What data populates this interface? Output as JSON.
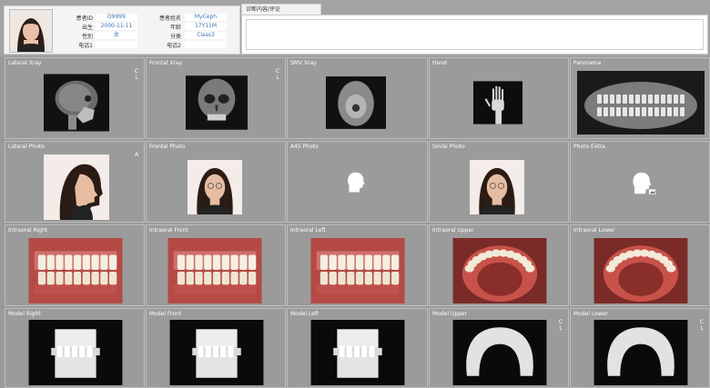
{
  "patient": {
    "fields": [
      {
        "label": "患者ID",
        "value": "D9999"
      },
      {
        "label": "出生",
        "value": "2000-11-11"
      },
      {
        "label": "性別",
        "value": "女"
      },
      {
        "label": "电话1",
        "value": ""
      },
      {
        "label": "患者姓名",
        "value": "MyCeph"
      },
      {
        "label": "年龄",
        "value": "17Y11M"
      },
      {
        "label": "分类",
        "value": "Class3"
      },
      {
        "label": "电话2",
        "value": ""
      }
    ]
  },
  "diagnosis": {
    "tab_label": "诊断内容/评论",
    "text": ""
  },
  "tiles": [
    {
      "title": "Lateral Xray",
      "corner": "C\nL"
    },
    {
      "title": "Frontal Xray",
      "corner": "C\nL"
    },
    {
      "title": "SMV Xray",
      "corner": ""
    },
    {
      "title": "Hand",
      "corner": ""
    },
    {
      "title": "Panorama",
      "corner": ""
    },
    {
      "title": "Lateral Photo",
      "corner": "A"
    },
    {
      "title": "Frontal Photo",
      "corner": ""
    },
    {
      "title": "A45 Photo",
      "corner": ""
    },
    {
      "title": "Smile Photo",
      "corner": ""
    },
    {
      "title": "Photo Extra",
      "corner": ""
    },
    {
      "title": "Intraoral Right",
      "corner": ""
    },
    {
      "title": "Intraoral Front",
      "corner": ""
    },
    {
      "title": "Intraoral Left",
      "corner": ""
    },
    {
      "title": "Intraoral Upper",
      "corner": ""
    },
    {
      "title": "Intraoral Lower",
      "corner": ""
    },
    {
      "title": "Model Right",
      "corner": ""
    },
    {
      "title": "Model Front",
      "corner": ""
    },
    {
      "title": "Model Left",
      "corner": ""
    },
    {
      "title": "Model Upper",
      "corner": "C\nL"
    },
    {
      "title": "Model Lower",
      "corner": "C\nL"
    }
  ],
  "icons": {
    "xray": "xray-image-icon",
    "photo": "patient-photo-icon",
    "placeholder": "head-silhouette-placeholder-icon",
    "intraoral": "intraoral-teeth-image-icon",
    "model": "dental-model-image-icon"
  }
}
